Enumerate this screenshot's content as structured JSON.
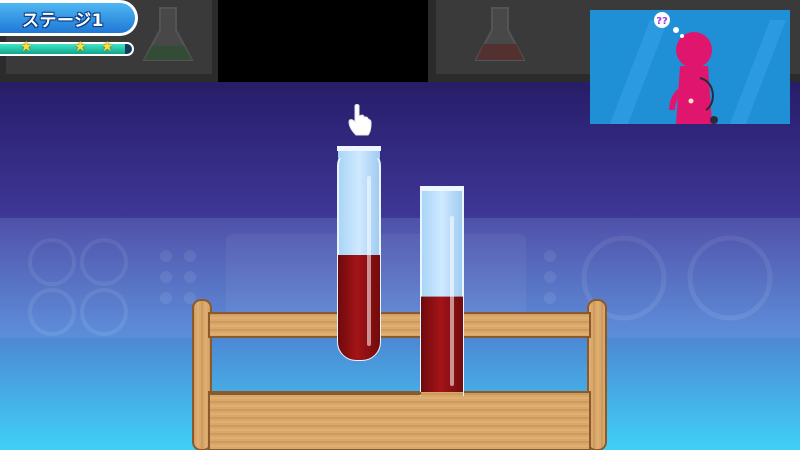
{
  "hud": {
    "stage_label": "ステージ1",
    "progress": 0.95,
    "stars": 3
  },
  "tubes": [
    {
      "name": "left",
      "liquid_level": 0.5
    },
    {
      "name": "right",
      "liquid_level": 0.48
    }
  ],
  "thought_bubble": "??",
  "icons": {
    "pointer": "hand-pointer-icon",
    "thought": "question-thought-icon"
  },
  "colors": {
    "liquid": "#9a0f12",
    "character": "#e0166e",
    "wood": "#d9a769",
    "stage_badge": "#2f93e6",
    "progress_fill": "#22c6a6"
  }
}
